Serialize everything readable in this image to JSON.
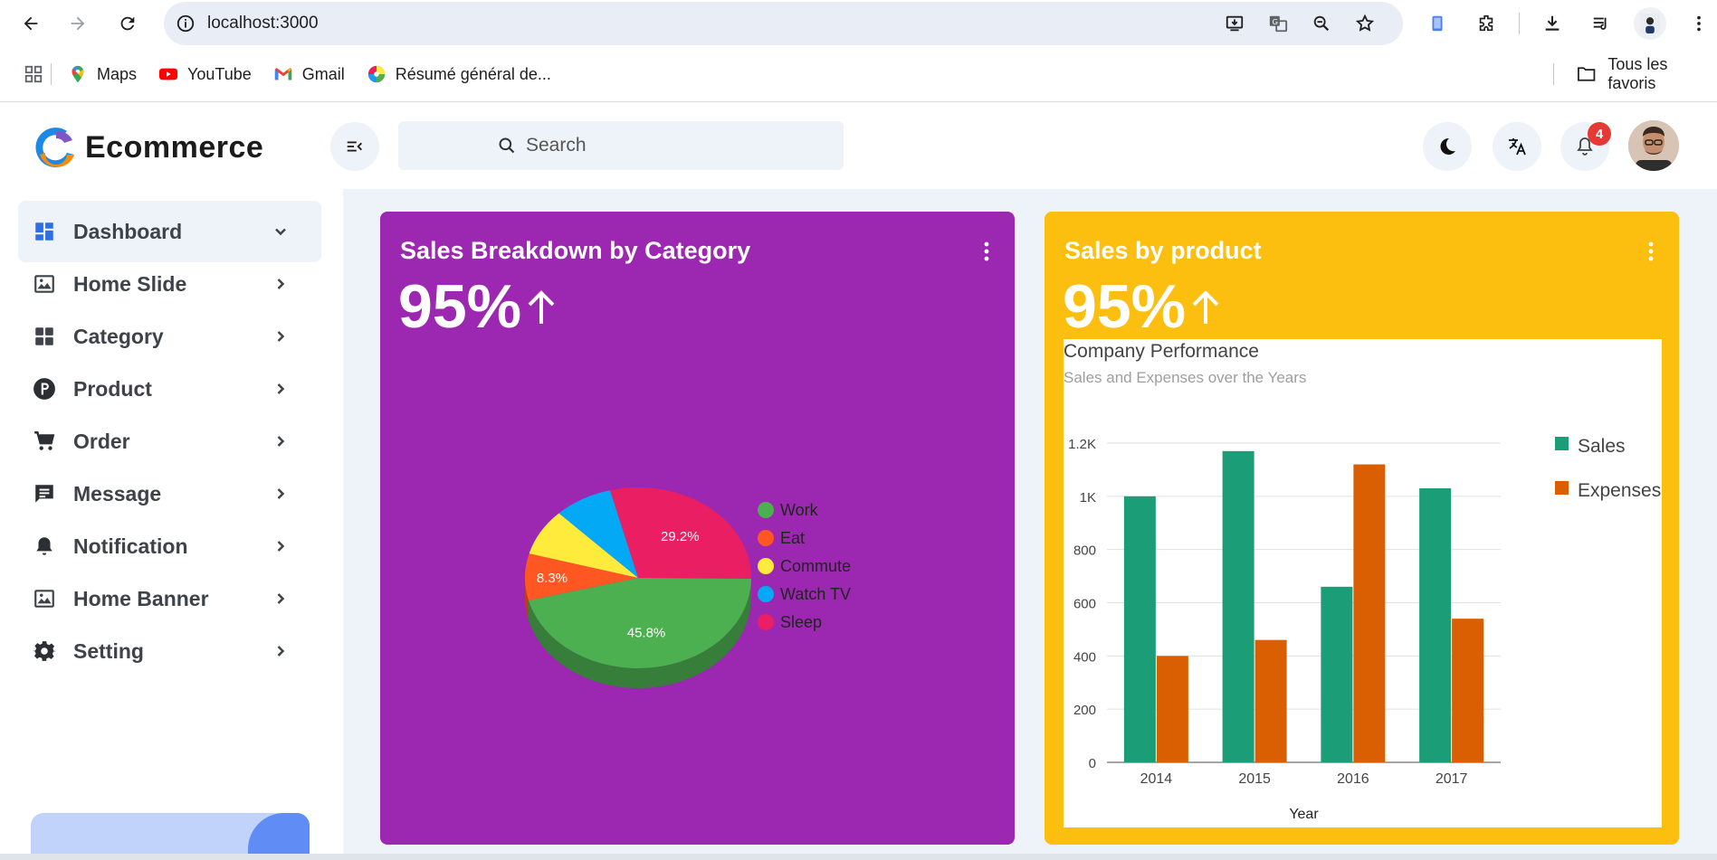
{
  "browser": {
    "url": "localhost:3000",
    "bookmarks": [
      {
        "label": "Maps",
        "icon": "maps-icon"
      },
      {
        "label": "YouTube",
        "icon": "youtube-icon"
      },
      {
        "label": "Gmail",
        "icon": "gmail-icon"
      },
      {
        "label": "Résumé général de...",
        "icon": "color-wheel-icon"
      }
    ],
    "all_bookmarks_label": "Tous les favoris"
  },
  "header": {
    "logo_text": "Ecommerce",
    "search_placeholder": "Search",
    "notification_count": "4"
  },
  "sidebar": {
    "items": [
      {
        "label": "Dashboard",
        "icon": "dashboard-icon",
        "active": true
      },
      {
        "label": "Home Slide",
        "icon": "image-icon"
      },
      {
        "label": "Category",
        "icon": "category-icon"
      },
      {
        "label": "Product",
        "icon": "product-icon"
      },
      {
        "label": "Order",
        "icon": "cart-icon"
      },
      {
        "label": "Message",
        "icon": "message-icon"
      },
      {
        "label": "Notification",
        "icon": "bell-icon"
      },
      {
        "label": "Home Banner",
        "icon": "image-icon"
      },
      {
        "label": "Setting",
        "icon": "gear-icon"
      }
    ]
  },
  "cards": {
    "category": {
      "title": "Sales Breakdown by Category",
      "percent": "95%",
      "color": "#9c27b0"
    },
    "product": {
      "title": "Sales by product",
      "percent": "95%",
      "color": "#fcbf0f"
    }
  },
  "chart_data": [
    {
      "type": "pie",
      "categories": [
        "Work",
        "Eat",
        "Commute",
        "Watch TV",
        "Sleep"
      ],
      "values": [
        11,
        2,
        2,
        2,
        7
      ],
      "slice_labels": [
        "45.8%",
        "8.3%",
        "",
        "",
        "29.2%"
      ],
      "colors": [
        "#4caf50",
        "#ff5722",
        "#ffeb3b",
        "#03a9f4",
        "#e91e63"
      ],
      "legend_position": "right",
      "is3D": true
    },
    {
      "type": "bar",
      "title": "Company Performance",
      "subtitle": "Sales and Expenses over the Years",
      "categories": [
        "2014",
        "2015",
        "2016",
        "2017"
      ],
      "series": [
        {
          "name": "Sales",
          "values": [
            1000,
            1170,
            660,
            1030
          ],
          "color": "#1b9e77"
        },
        {
          "name": "Expenses",
          "values": [
            400,
            460,
            1120,
            540
          ],
          "color": "#d95f02"
        }
      ],
      "xlabel": "Year",
      "ylabel": "",
      "ylim": [
        0,
        1200
      ],
      "yticks": [
        "0",
        "200",
        "400",
        "600",
        "800",
        "1K",
        "1.2K"
      ],
      "legend_position": "right",
      "grid": true
    }
  ]
}
